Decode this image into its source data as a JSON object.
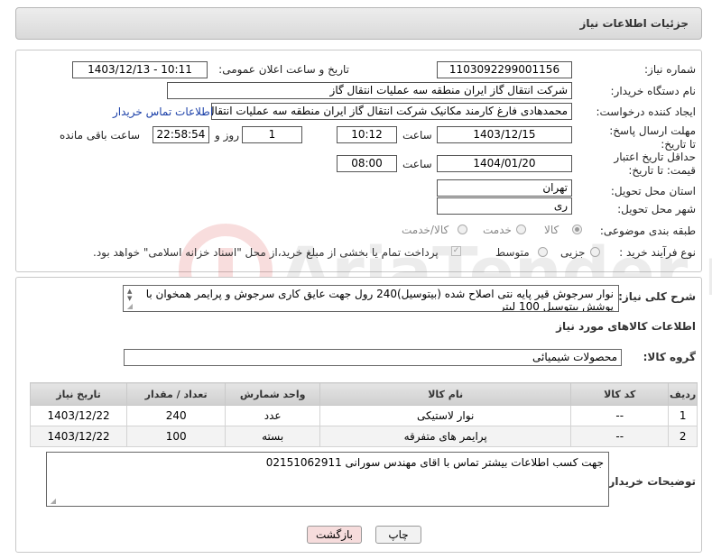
{
  "header": {
    "title": "جزئیات اطلاعات نیاز"
  },
  "form": {
    "need_number_label": "شماره نیاز:",
    "need_number": "1103092299001156",
    "announce_label": "تاریخ و ساعت اعلان عمومی:",
    "announce_value": "1403/12/13 - 10:11",
    "buyer_org_label": "نام دستگاه خریدار:",
    "buyer_org": "شرکت انتقال گاز ایران منطقه سه عملیات انتقال گاز",
    "creator_label": "ایجاد کننده درخواست:",
    "creator": "محمدهادی فارغ کارمند مکانیک شرکت انتقال گاز ایران منطقه سه عملیات انتقال",
    "buyer_contact_link": "اطلاعات تماس خریدار",
    "deadline_label": "مهلت ارسال پاسخ: تا تاریخ:",
    "deadline_date": "1403/12/15",
    "time_label": "ساعت",
    "deadline_time": "10:12",
    "days_value": "1",
    "days_label": "روز و",
    "countdown": "22:58:54",
    "remaining_label": "ساعت باقی مانده",
    "validity_label": "حداقل تاریخ اعتبار قیمت: تا تاریخ:",
    "validity_date": "1404/01/20",
    "validity_time": "08:00",
    "province_label": "استان محل تحویل:",
    "province": "تهران",
    "city_label": "شهر محل تحویل:",
    "city": "ری",
    "category_label": "طبقه بندی موضوعی:",
    "category_options": [
      "کالا",
      "خدمت",
      "کالا/خدمت"
    ],
    "process_label": "نوع فرآیند خرید :",
    "process_options": [
      "جزیی",
      "متوسط"
    ],
    "payment_note": "پرداخت تمام یا بخشی از مبلغ خرید،از محل \"اسناد خزانه اسلامی\" خواهد بود."
  },
  "watermark": {
    "text": "AriaTender.neT"
  },
  "summary": {
    "label": "شرح کلی نیاز:",
    "text": "نوار سرجوش قیر پایه نتی اصلاح شده (بیتوسیل)240 رول جهت عایق کاری سرجوش و پرایمر همخوان با پوشش بیتوسیل 100 لیتر"
  },
  "goods": {
    "section_title": "اطلاعات کالاهای مورد نیاز",
    "group_label": "گروه کالا:",
    "group_value": "محصولات شیمیائی",
    "columns": [
      "ردیف",
      "کد کالا",
      "نام کالا",
      "واحد شمارش",
      "تعداد / مقدار",
      "تاریخ نیاز"
    ],
    "rows": [
      [
        "1",
        "--",
        "نوار لاستیکی",
        "عدد",
        "240",
        "1403/12/22"
      ],
      [
        "2",
        "--",
        "پرایمر های متفرقه",
        "بسته",
        "100",
        "1403/12/22"
      ]
    ]
  },
  "buyer_notes": {
    "label": "توضیحات خریدار:",
    "text": "جهت کسب اطلاعات بیشتر تماس با اقای مهندس سورانی 02151062911"
  },
  "buttons": {
    "print": "چاپ",
    "back": "بازگشت"
  },
  "colors": {
    "link": "#1a3fa8",
    "back_button_bg": "#f6dcdc",
    "print_button_bg": "#f2f2f2"
  }
}
